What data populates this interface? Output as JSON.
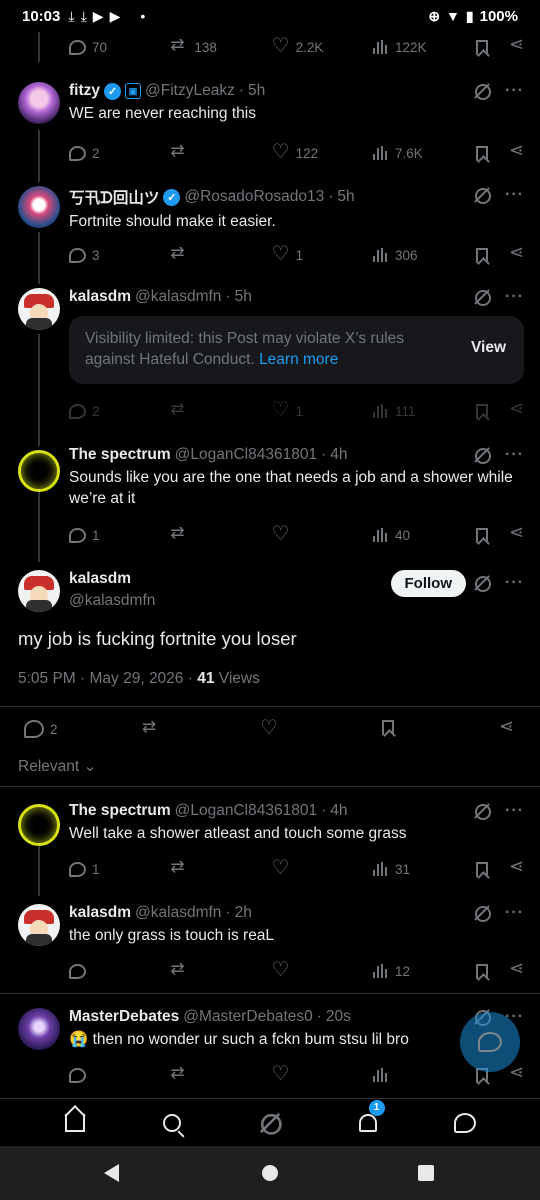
{
  "status_bar": {
    "time": "10:03",
    "battery": "100%"
  },
  "top_metrics": {
    "replies": "70",
    "reposts": "138",
    "likes": "2.2K",
    "views": "122K"
  },
  "replies_above": [
    {
      "name": "fitzy",
      "handle": "@FitzyLeakz",
      "age": "5h",
      "text": "WE are never reaching this",
      "replies": "2",
      "reposts": "",
      "likes": "122",
      "views": "7.6K"
    },
    {
      "name": "丂卂ᗪ回山ツ",
      "handle": "@RosadoRosado13",
      "age": "5h",
      "text": "Fortnite should make it easier.",
      "replies": "3",
      "reposts": "",
      "likes": "1",
      "views": "306"
    },
    {
      "name": "kalasdm",
      "handle": "@kalasdmfn",
      "age": "5h",
      "limited_text": "Visibility limited: this Post may violate X’s rules against Hateful Conduct.",
      "learn_more": "Learn more",
      "view_label": "View",
      "replies": "2",
      "reposts": "",
      "likes": "1",
      "views": "111"
    },
    {
      "name": "The spectrum",
      "handle": "@LoganCl84361801",
      "age": "4h",
      "text": "Sounds like you are the one that needs a job and a shower while we’re at it",
      "replies": "1",
      "reposts": "",
      "likes": "",
      "views": "40"
    }
  ],
  "focal": {
    "name": "kalasdm",
    "handle": "@kalasdmfn",
    "follow_label": "Follow",
    "text": "my job is fucking fortnite you loser",
    "timestamp": "5:05 PM · May 29, 2026 · ",
    "views_count": "41",
    "views_label": "Views",
    "replies": "2",
    "sort_label": "Relevant"
  },
  "replies_below": [
    {
      "name": "The spectrum",
      "handle": "@LoganCl84361801",
      "age": "4h",
      "text": "Well take a shower atleast and touch some grass",
      "replies": "1",
      "likes": "",
      "views": "31"
    },
    {
      "name": "kalasdm",
      "handle": "@kalasdmfn",
      "age": "2h",
      "text": "the only grass is touch is reaL",
      "replies": "",
      "likes": "",
      "views": "12"
    },
    {
      "name": "MasterDebates",
      "handle": "@MasterDebates0",
      "age": "20s",
      "emoji": "😭",
      "text": "then no wonder ur such a fckn bum stsu lil bro",
      "replies": "",
      "likes": "",
      "views": ""
    }
  ],
  "bottom_nav": {
    "notifications_badge": "1"
  },
  "colors": {
    "background": "#000000",
    "accent": "#1d9bf0",
    "muted": "#71767b",
    "text": "#e7e9ea"
  }
}
